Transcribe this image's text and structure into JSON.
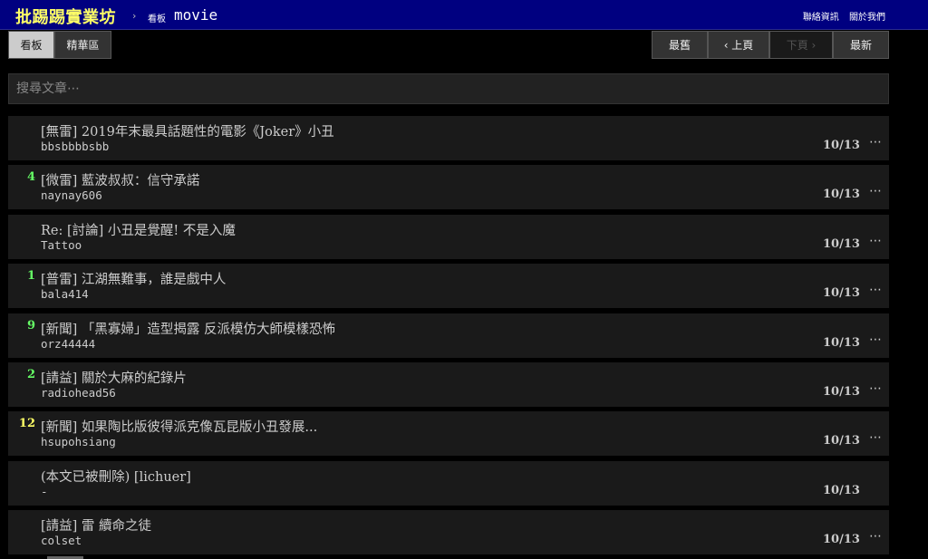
{
  "header": {
    "site_name": "批踢踢實業坊",
    "separator": "›",
    "board_tag": "看板",
    "board_name": "movie",
    "links": [
      "聯絡資訊",
      "關於我們"
    ]
  },
  "tabs": {
    "board": "看板",
    "digest": "精華區"
  },
  "pager": {
    "oldest": "最舊",
    "prev": "‹ 上頁",
    "next": "下頁 ›",
    "newest": "最新"
  },
  "search": {
    "placeholder": "搜尋文章⋯"
  },
  "colors": {
    "nrec_low": "#66ff66",
    "nrec_high": "#ffff66"
  },
  "posts": [
    {
      "nrec": "",
      "title": "[無雷] 2019年末最具話題性的電影《Joker》小丑",
      "author": "bbsbbbbsbb",
      "date": "10/13",
      "more": "⋯"
    },
    {
      "nrec": "4",
      "title": "[微雷] 藍波叔叔：信守承諾",
      "author": "naynay606",
      "date": "10/13",
      "more": "⋯"
    },
    {
      "nrec": "",
      "title": "Re: [討論] 小丑是覺醒! 不是入魔",
      "author": "Tattoo",
      "date": "10/13",
      "more": "⋯"
    },
    {
      "nrec": "1",
      "title": "[普雷] 江湖無難事，誰是戲中人",
      "author": "bala414",
      "date": "10/13",
      "more": "⋯"
    },
    {
      "nrec": "9",
      "title": "[新聞] 「黑寡婦」造型揭露 反派模仿大師模樣恐怖",
      "author": "orz44444",
      "date": "10/13",
      "more": "⋯"
    },
    {
      "nrec": "2",
      "title": "[請益] 關於大麻的紀錄片",
      "author": "radiohead56",
      "date": "10/13",
      "more": "⋯"
    },
    {
      "nrec": "12",
      "title": "[新聞] 如果陶比版彼得派克像瓦昆版小丑發展...",
      "author": "hsupohsiang",
      "date": "10/13",
      "more": "⋯"
    },
    {
      "nrec": "",
      "title": "(本文已被刪除) [lichuer]",
      "author": "-",
      "date": "10/13",
      "more": ""
    },
    {
      "nrec": "",
      "title": "[請益] 雷 續命之徒",
      "author": "colset",
      "date": "10/13",
      "more": "⋯"
    }
  ]
}
